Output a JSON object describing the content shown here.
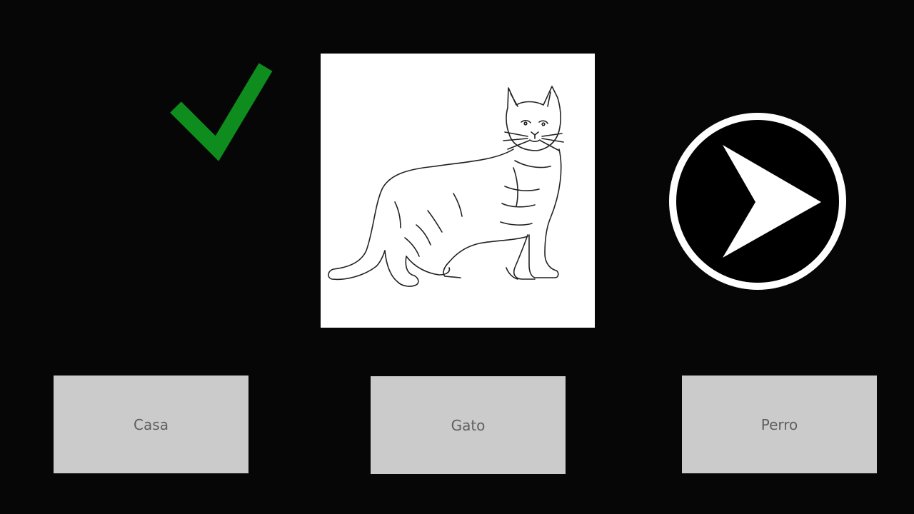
{
  "quiz": {
    "feedback_icon": "check-icon",
    "feedback_color": "#0e8c1d",
    "picture_icon": "cat-outline",
    "next_icon": "arrow-right-circle-icon",
    "options": [
      {
        "label": "Casa"
      },
      {
        "label": "Gato"
      },
      {
        "label": "Perro"
      }
    ]
  }
}
